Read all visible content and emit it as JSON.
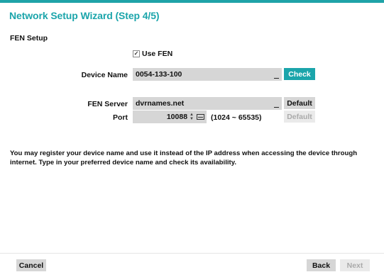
{
  "wizard": {
    "title": "Network Setup Wizard (Step 4/5)",
    "section": "FEN Setup",
    "accent_color": "#1ba5ab"
  },
  "use_fen": {
    "label": "Use FEN",
    "checked": true
  },
  "device_name": {
    "label": "Device Name",
    "value": "0054-133-100",
    "button": "Check"
  },
  "fen_server": {
    "label": "FEN Server",
    "value": "dvrnames.net",
    "button": "Default"
  },
  "port": {
    "label": "Port",
    "value": "10088",
    "range": "(1024 ~ 65535)",
    "button": "Default",
    "icons": [
      "spinner-icon",
      "keyboard-icon"
    ]
  },
  "description": "You may register your device name and use it instead of the IP address when accessing the device through internet. Type in your preferred device name and check its availability.",
  "footer": {
    "cancel": "Cancel",
    "back": "Back",
    "next": "Next"
  }
}
